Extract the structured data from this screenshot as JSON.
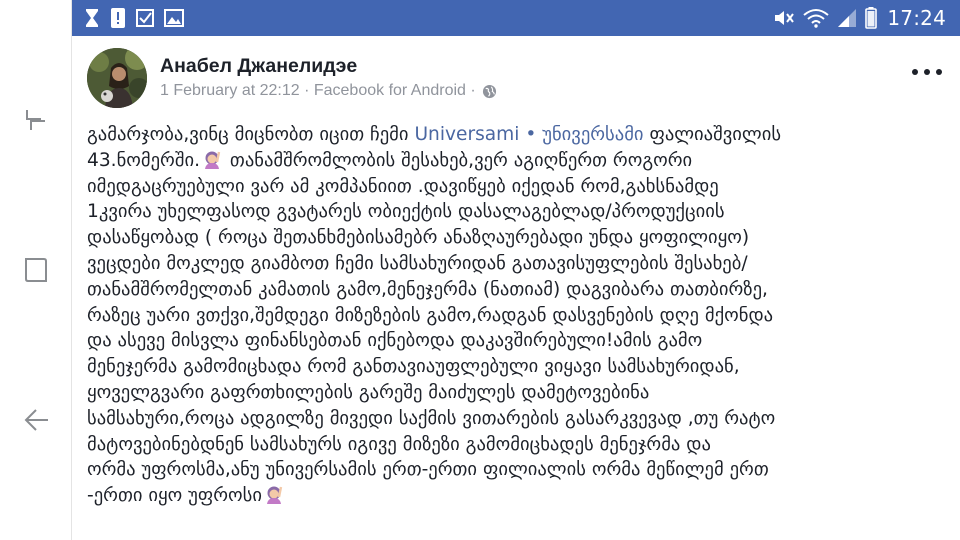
{
  "status_bar": {
    "time": "17:24",
    "left_icons": [
      "hourglass-icon",
      "alert-icon",
      "checkbox-icon",
      "image-icon"
    ],
    "right_icons": [
      "mute-icon",
      "wifi-icon",
      "signal-icon",
      "battery-icon"
    ],
    "background": "#4266b2"
  },
  "nav": {
    "icons": [
      "recent-apps-icon",
      "home-icon",
      "back-icon"
    ]
  },
  "post": {
    "author": "Анабел Джанелидэе",
    "timestamp": "1 February at 22:12 · Facebook for Android ·",
    "privacy_icon": "globe-icon",
    "link_color": "#4b67a1",
    "lines": [
      {
        "before": "გამარჯობა,ვინც მიცნობთ იცით ჩემი ",
        "link": "Universami • უნივერსამი",
        "after": " ფალიაშვილის"
      },
      {
        "before": "43.ნომერში.",
        "emoji": true,
        "after": " თანამშრომლობის შესახებ,ვერ აგიღწერთ როგორი"
      },
      {
        "text": "იმედგაცრუებული ვარ ამ კომპანიით .დავიწყებ იქედან რომ,გახსნამდე"
      },
      {
        "text": "1კვირა უხელფასოდ გვატარეს ობიექტის დასალაგებლად/პროდუქციის"
      },
      {
        "text": "დასაწყობად ( როცა შეთანხმებისამებრ ანაზღაურებადი უნდა ყოფილიყო)"
      },
      {
        "text": "ვეცდები მოკლედ გიამბოთ ჩემი სამსახურიდან გათავისუფლების შესახებ/"
      },
      {
        "text": "თანამშრომელთან კამათის გამო,მენეჯერმა (ნათიამ) დაგვიბარა თათბირზე,"
      },
      {
        "text": "რაზეც უარი ვთქვი,შემდეგი მიზეზების გამო,რადგან დასვენების დღე მქონდა"
      },
      {
        "text": "და ასევე მისვლა ფინანსებთან იქნებოდა დაკავშირებული!ამის გამო"
      },
      {
        "text": "მენეჯერმა გამომიცხადა რომ განთავიაუფლებული ვიყავი სამსახურიდან,"
      },
      {
        "text": "ყოველგვარი გაფრთხილების გარეშე მაიძულეს დამეტოვებინა"
      },
      {
        "text": "სამსახური,როცა ადგილზე მივედი საქმის ვითარების გასარკვევად ,თუ რატო"
      },
      {
        "text": "მატოვებინებდნენ სამსახურს იგივე მიზეზი გამომიცხადეს მენეჯრმა და"
      },
      {
        "text": "ორმა უფროსმა,ანუ უნივერსამის ერთ-ერთი ფილიალის ორმა მეწილემ ერთ"
      },
      {
        "before": "-ერთი იყო უფროსი",
        "emoji": true,
        "after": ""
      }
    ]
  }
}
